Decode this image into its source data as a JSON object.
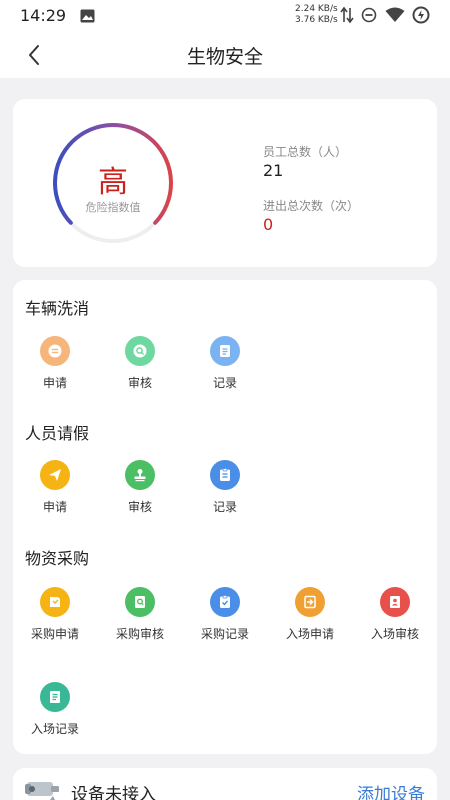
{
  "status_bar": {
    "time": "14:29",
    "speed_up": "2.24 KB/s",
    "speed_down": "3.76 KB/s"
  },
  "navbar": {
    "title": "生物安全"
  },
  "overview": {
    "risk_level": "高",
    "risk_label": "危险指数值",
    "employees_label": "员工总数（人）",
    "employees_value": "21",
    "entries_label": "进出总次数（次）",
    "entries_value": "0"
  },
  "sections": {
    "vehicle": {
      "title": "车辆洗消",
      "items": [
        "申请",
        "审核",
        "记录"
      ]
    },
    "leave": {
      "title": "人员请假",
      "items": [
        "申请",
        "审核",
        "记录"
      ]
    },
    "purchase": {
      "title": "物资采购",
      "items": [
        "采购申请",
        "采购审核",
        "采购记录",
        "入场申请",
        "入场审核",
        "入场记录"
      ]
    }
  },
  "colors": {
    "orange_soft": "#f6b57a",
    "green_soft": "#6fd7a0",
    "blue_soft": "#7ab2f2",
    "yellow": "#f5b414",
    "green": "#4cbe63",
    "blue": "#4a8ee8",
    "orange": "#f0a032",
    "red": "#e8504a",
    "teal": "#3ab795",
    "accent_red": "#c9231d",
    "link_blue": "#3a7bd5"
  },
  "device": {
    "status": "设备未接入",
    "add_label": "添加设备"
  }
}
